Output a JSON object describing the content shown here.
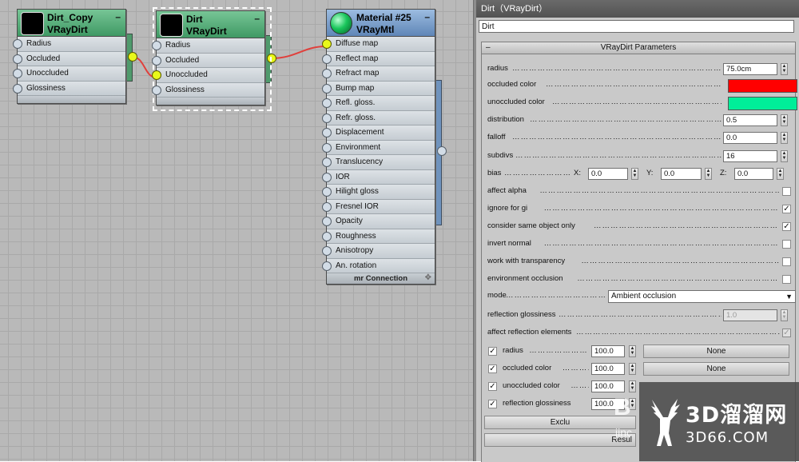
{
  "nodes": {
    "dirt_copy": {
      "name": "Dirt_Copy",
      "type": "VRayDirt",
      "slots": [
        "Radius",
        "Occluded",
        "Unoccluded",
        "Glossiness"
      ]
    },
    "dirt": {
      "name": "Dirt",
      "type": "VRayDirt",
      "slots": [
        "Radius",
        "Occluded",
        "Unoccluded",
        "Glossiness"
      ]
    },
    "material": {
      "name": "Material #25",
      "type": "VRayMtl",
      "slots": [
        "Diffuse map",
        "Reflect map",
        "Refract map",
        "Bump map",
        "Refl. gloss.",
        "Refr. gloss.",
        "Displacement",
        "Environment",
        "Translucency",
        "IOR",
        "Hilight gloss",
        "Fresnel IOR",
        "Opacity",
        "Roughness",
        "Anisotropy",
        "An. rotation"
      ],
      "footer": "mr Connection"
    }
  },
  "panel": {
    "title": "Dirt（VRayDirt）",
    "name_value": "Dirt",
    "rollout_title": "VRayDirt Parameters",
    "radius_label": "radius",
    "radius_value": "75.0cm",
    "occluded_label": "occluded color",
    "occluded_color": "#ff0000",
    "unoccluded_label": "unoccluded color",
    "unoccluded_color": "#00ee99",
    "distribution_label": "distribution",
    "distribution_value": "0.5",
    "falloff_label": "falloff",
    "falloff_value": "0.0",
    "subdivs_label": "subdivs",
    "subdivs_value": "16",
    "bias_label": "bias",
    "bias_x_label": "X:",
    "bias_x": "0.0",
    "bias_y_label": "Y:",
    "bias_y": "0.0",
    "bias_z_label": "Z:",
    "bias_z": "0.0",
    "checks": [
      {
        "label": "affect alpha",
        "checked": false
      },
      {
        "label": "ignore for gi",
        "checked": true
      },
      {
        "label": "consider same object only",
        "checked": true
      },
      {
        "label": "invert normal",
        "checked": false
      },
      {
        "label": "work with transparency",
        "checked": false
      },
      {
        "label": "environment occlusion",
        "checked": false
      }
    ],
    "mode_label": "mode",
    "mode_value": "Ambient occlusion",
    "refl_gloss_label": "reflection glossiness",
    "refl_gloss_value": "1.0",
    "affect_refl_label": "affect reflection elements",
    "maps": [
      {
        "label": "radius",
        "value": "100.0",
        "button": "None"
      },
      {
        "label": "occluded color",
        "value": "100.0",
        "button": "None"
      },
      {
        "label": "unoccluded color",
        "value": "100.0",
        "button": ""
      },
      {
        "label": "reflection glossiness",
        "value": "100.0",
        "button": ""
      }
    ],
    "exclude_button": "Exclu",
    "result_button": "Resul"
  },
  "watermark": {
    "brand": "3D溜溜网",
    "url": "3D66.COM",
    "letter": "B",
    "sub": "jinc"
  },
  "colors": {
    "green_node": "#4f9a6c",
    "blue_node": "#6f93bd",
    "socket_active": "#e9f81a",
    "wire": "#e0403c"
  }
}
